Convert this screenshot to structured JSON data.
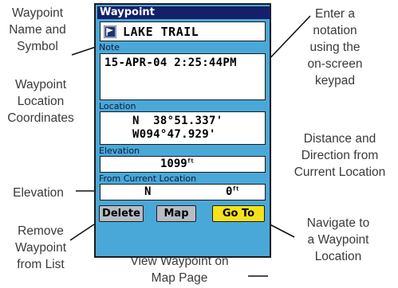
{
  "device": {
    "title": "Waypoint",
    "waypoint_name": "LAKE TRAIL",
    "symbol_icon": "waypoint-flag-icon",
    "note_label": "Note",
    "note_text": "15-APR-04 2:25:44PM",
    "location_label": "Location",
    "latitude": "N  38°51.337'",
    "longitude": "W094°47.929'",
    "elevation_label": "Elevation",
    "elevation_value": "1099",
    "elevation_unit": "ft",
    "from_label": "From Current Location",
    "direction": "N",
    "distance_value": "0",
    "distance_unit": "ft",
    "buttons": {
      "delete": "Delete",
      "map": "Map",
      "goto": "Go To"
    },
    "colors": {
      "body": "#4aa8d8",
      "title_bar": "#16206a",
      "goto_button": "#f4e21c",
      "button": "#b6bcc4"
    }
  },
  "callouts": {
    "name_symbol": [
      "Waypoint",
      "Name and",
      "Symbol"
    ],
    "location_coords": [
      "Waypoint",
      "Location",
      "Coordinates"
    ],
    "elevation": [
      "Elevation"
    ],
    "remove": [
      "Remove",
      "Waypoint",
      "from List"
    ],
    "notation": [
      "Enter a",
      "notation",
      "using the",
      "on-screen",
      "keypad"
    ],
    "distance_direction": [
      "Distance and",
      "Direction from",
      "Current Location"
    ],
    "navigate": [
      "Navigate to",
      "a Waypoint",
      "Location"
    ],
    "view_map": [
      "View Waypoint on",
      "Map Page"
    ]
  }
}
